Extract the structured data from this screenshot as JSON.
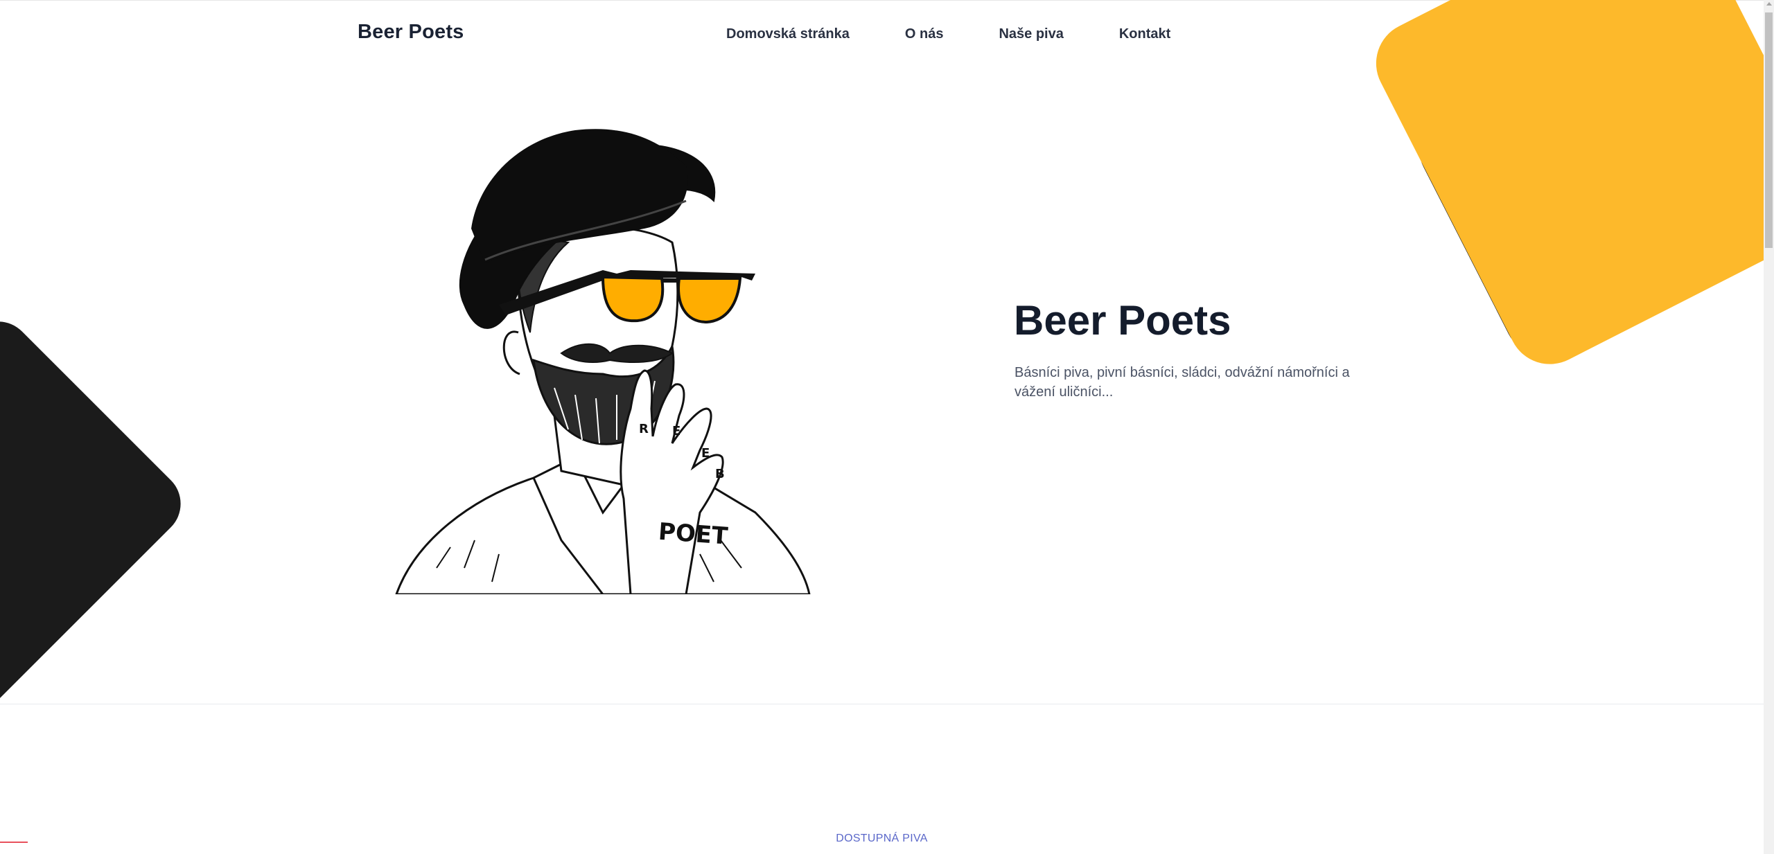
{
  "header": {
    "logo": "Beer Poets",
    "nav": [
      {
        "label": "Domovská stránka"
      },
      {
        "label": "O nás"
      },
      {
        "label": "Naše piva"
      },
      {
        "label": "Kontakt"
      }
    ]
  },
  "hero": {
    "title": "Beer Poets",
    "description": "Básníci piva, pivní básníci, sládci, odvážní námořníci a vážení uličníci...",
    "illustration_tattoo": "POET"
  },
  "section": {
    "label": "DOSTUPNÁ PIVA"
  },
  "colors": {
    "accent_yellow": "#fdb92b",
    "dark": "#1b1b1b",
    "text_dark": "#141c2c",
    "label_blue": "#5a67c9"
  }
}
